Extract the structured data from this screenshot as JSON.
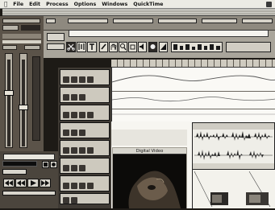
{
  "menubar": {
    "apple_glyph": "",
    "items": [
      "File",
      "Edit",
      "Process",
      "Options",
      "Windows",
      "QuickTime"
    ]
  },
  "window": {
    "title": "Digital Video"
  },
  "colors": {
    "panel_dark": "#5b5349",
    "toolbar": "#a9a59b",
    "lane_bg": "#faf9f5",
    "curve": "#555555"
  },
  "icons": [
    "apple-icon",
    "play-icon",
    "rewind-icon",
    "fast-forward-icon",
    "stop-icon",
    "record-icon",
    "pencil-icon",
    "speaker-icon"
  ]
}
